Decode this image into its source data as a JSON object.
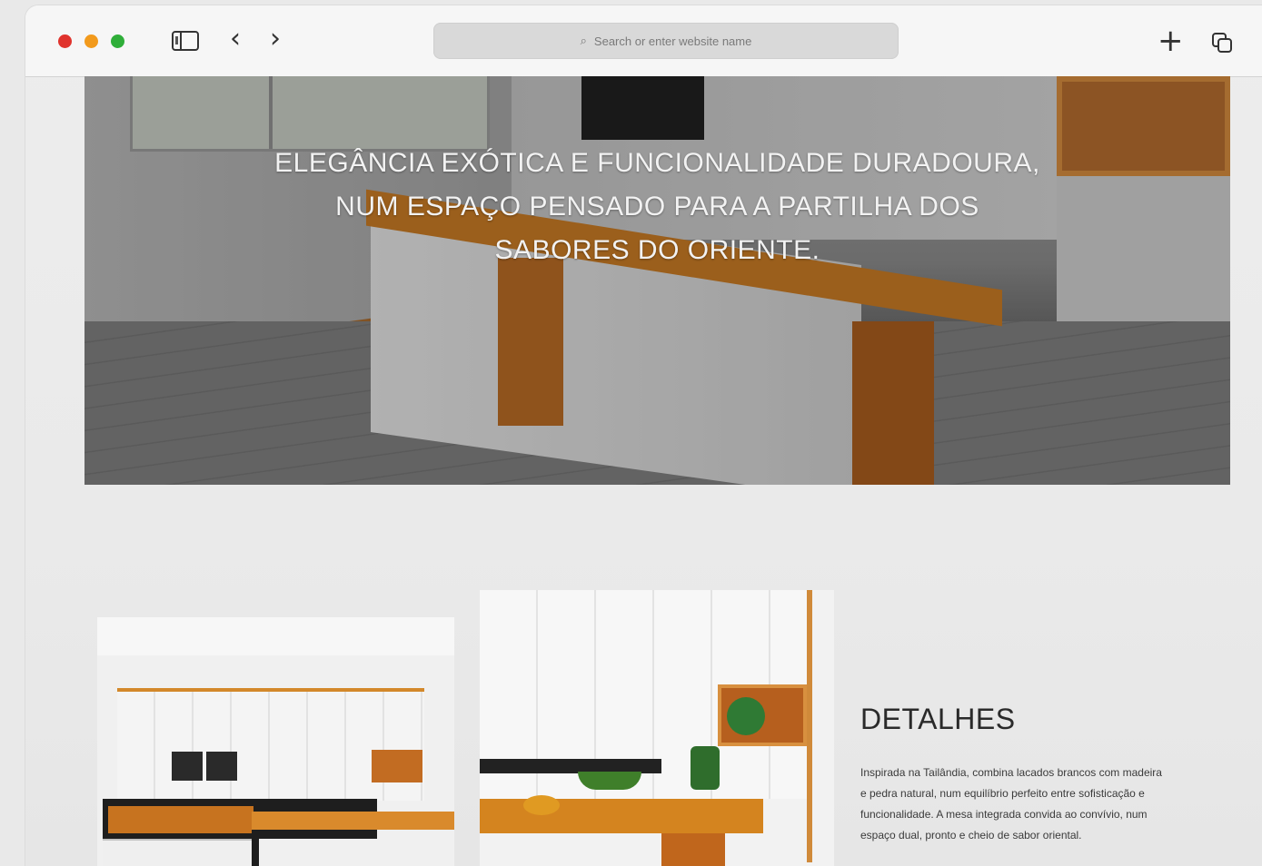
{
  "browser": {
    "address_placeholder": "Search or enter website name",
    "icons": [
      "close-dot",
      "minimize-dot",
      "zoom-dot",
      "sidebar-icon",
      "back-icon",
      "forward-icon",
      "search-icon",
      "new-tab-icon",
      "tab-overview-icon"
    ],
    "traffic_colors": {
      "close": "#e0332d",
      "minimize": "#f29a1c",
      "zoom": "#2fae39"
    }
  },
  "hero": {
    "lines": [
      "ELEGÂNCIA EXÓTICA E FUNCIONALIDADE DURADOURA,",
      "NUM ESPAÇO PENSADO PARA A PARTILHA DOS",
      "SABORES DO ORIENTE."
    ]
  },
  "details": {
    "title": "DETALHES",
    "lines": [
      "Inspirada na Tailândia, combina lacados brancos com madeira",
      "e pedra natural, num equilíbrio perfeito entre sofisticação e",
      "funcionalidade. A mesa integrada convida ao convívio, num",
      "espaço dual, pronto e cheio de sabor oriental."
    ]
  },
  "colors": {
    "accent_wood": "#c9781f",
    "page_bg": "#ebebeb",
    "text_dark": "#2a2a2a"
  }
}
